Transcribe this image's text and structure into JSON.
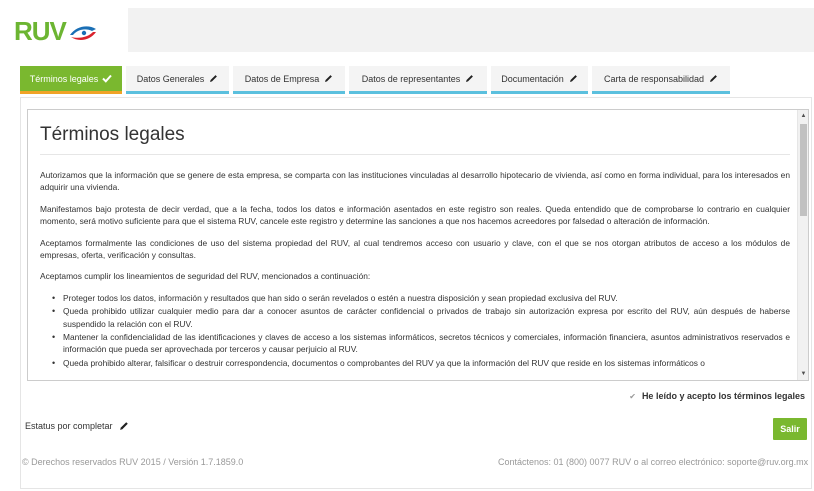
{
  "brand": {
    "logo_text": "RUV",
    "colors": {
      "green": "#7ab82f",
      "orange": "#f0a326",
      "blue": "#5bc0de",
      "logo_blue": "#1a6fb5",
      "logo_red": "#d9232d"
    }
  },
  "tabs": [
    {
      "label": "Términos legales",
      "active": true,
      "icon": "check-icon"
    },
    {
      "label": "Datos Generales",
      "active": false,
      "icon": "pencil-icon"
    },
    {
      "label": "Datos de Empresa",
      "active": false,
      "icon": "pencil-icon"
    },
    {
      "label": "Datos de representantes",
      "active": false,
      "icon": "pencil-icon"
    },
    {
      "label": "Documentación",
      "active": false,
      "icon": "pencil-icon"
    },
    {
      "label": "Carta de responsabilidad",
      "active": false,
      "icon": "pencil-icon"
    }
  ],
  "legal": {
    "title": "Términos legales",
    "paragraphs": [
      "Autorizamos que la información que se genere de esta empresa, se comparta con las instituciones vinculadas al desarrollo hipotecario de vivienda, así como en forma individual, para los interesados en adquirir una vivienda.",
      "Manifestamos bajo protesta de decir verdad, que a la fecha, todos los datos e información asentados en este registro son reales. Queda entendido que de comprobarse lo contrario en cualquier momento, será motivo suficiente para que el sistema RUV, cancele este registro y determine las sanciones a que nos hacemos acreedores por falsedad o alteración de información.",
      "Aceptamos formalmente las condiciones de uso del sistema propiedad del RUV, al cual tendremos acceso con usuario y clave, con el que se nos otorgan atributos de acceso a los módulos de empresas, oferta, verificación y consultas.",
      "Aceptamos cumplir los lineamientos de seguridad del RUV, mencionados a continuación:"
    ],
    "bullets": [
      "Proteger todos los datos, información y resultados que han sido o serán revelados o estén a nuestra disposición y sean propiedad exclusiva del RUV.",
      "Queda prohibido utilizar cualquier medio para dar a conocer asuntos de carácter confidencial o privados de trabajo sin autorización expresa por escrito del RUV, aún después de haberse suspendido la relación con el RUV.",
      "Mantener la confidencialidad de las identificaciones y claves de acceso a los sistemas informáticos, secretos técnicos y comerciales, información financiera, asuntos administrativos reservados e información que pueda ser aprovechada por terceros y causar perjuicio al RUV.",
      "Queda prohibido alterar, falsificar o destruir correspondencia, documentos o comprobantes del RUV ya que la información del RUV que reside en los sistemas informáticos o"
    ]
  },
  "accept": {
    "label": "He leído y acepto los términos legales",
    "checked": true
  },
  "status": {
    "label": "Estatus por completar"
  },
  "buttons": {
    "exit": "Salir"
  },
  "footer": {
    "left": "© Derechos reservados RUV 2015 / Versión 1.7.1859.0",
    "right": "Contáctenos: 01 (800) 0077 RUV o al correo electrónico: soporte@ruv.org.mx"
  }
}
